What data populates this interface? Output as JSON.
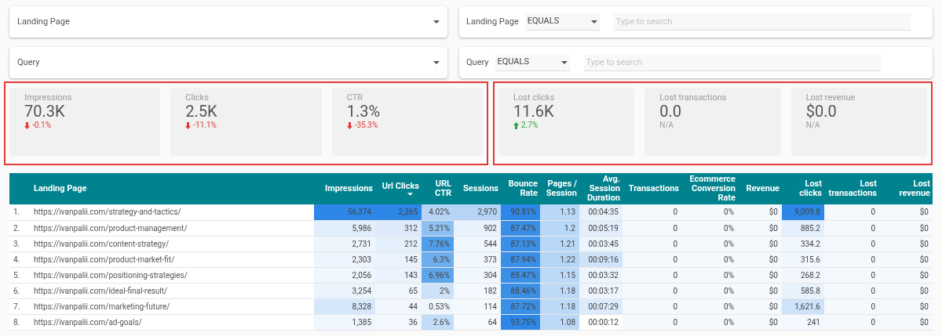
{
  "filters": [
    {
      "label": "Landing Page"
    },
    {
      "label": "Query"
    }
  ],
  "search_filters": [
    {
      "label": "Landing Page",
      "operator": "EQUALS",
      "placeholder": "Type to search"
    },
    {
      "label": "Query",
      "operator": "EQUALS",
      "placeholder": "Type to search"
    }
  ],
  "scorecard_groups": [
    {
      "cards": [
        {
          "title": "Impressions",
          "value": "70.3K",
          "rising": false,
          "delta": "-0.1%",
          "color": "#e53935"
        },
        {
          "title": "Clicks",
          "value": "2.5K",
          "rising": false,
          "delta": "-11.1%",
          "color": "#e53935"
        },
        {
          "title": "CTR",
          "value": "1.3%",
          "rising": false,
          "delta": "-35.3%",
          "color": "#e53935"
        }
      ]
    },
    {
      "cards": [
        {
          "title": "Lost clicks",
          "value": "11.6K",
          "rising": true,
          "delta": "2.7%",
          "color": "#2e9e44"
        },
        {
          "title": "Lost transactions",
          "value": "0.0",
          "delta": "N/A"
        },
        {
          "title": "Lost revenue",
          "value": "$0.0",
          "delta": "N/A"
        }
      ]
    }
  ],
  "table": {
    "columns": [
      {
        "label": "Landing Page",
        "sorted": false
      },
      {
        "label": "Impressions",
        "sorted": false
      },
      {
        "label": "Url Clicks",
        "sorted": true
      },
      {
        "label": "URL CTR",
        "sorted": false
      },
      {
        "label": "Sessions",
        "sorted": false
      },
      {
        "label": "Bounce Rate",
        "sorted": false
      },
      {
        "label": "Pages / Session",
        "sorted": false
      },
      {
        "label": "Avg. Session Duration",
        "sorted": false
      },
      {
        "label": "Transactions",
        "sorted": false
      },
      {
        "label": "Ecommerce Conversion Rate",
        "sorted": false
      },
      {
        "label": "Revenue",
        "sorted": false
      },
      {
        "label": "Lost clicks",
        "sorted": false
      },
      {
        "label": "Lost transactions",
        "sorted": false
      },
      {
        "label": "Lost revenue",
        "sorted": false
      }
    ],
    "rows": [
      {
        "index": "1.",
        "cells": [
          {
            "text": "https://ivanpalii.com/strategy-and-tactics/"
          },
          {
            "text": "56,374",
            "color": "#2c87e6"
          },
          {
            "text": "2,265",
            "color": "#2c87e6"
          },
          {
            "text": "4.02%",
            "color": "#b6d5f6"
          },
          {
            "text": "2,970",
            "color": "#b6d5f6"
          },
          {
            "text": "90.81%",
            "color": "#2c87e6"
          },
          {
            "text": "1.13",
            "color": "#b9d8f7"
          },
          {
            "text": "00:04:35",
            "color": "#e6f1fc"
          },
          {
            "text": "0",
            "color": "#f5f9fe"
          },
          {
            "text": "0%",
            "color": "#f5f9fe"
          },
          {
            "text": "$0",
            "color": "#f5f9fe"
          },
          {
            "text": "9,009.8",
            "color": "#2c87e6"
          },
          {
            "text": "0",
            "color": "#f5f9fe"
          },
          {
            "text": "$0",
            "color": "#f5f9fe"
          }
        ]
      },
      {
        "index": "2.",
        "cells": [
          {
            "text": "https://ivanpalii.com/product-management/"
          },
          {
            "text": "5,986",
            "color": "#e1eefc"
          },
          {
            "text": "312",
            "color": "#dceafb"
          },
          {
            "text": "5.21%",
            "color": "#8fc0f2"
          },
          {
            "text": "902",
            "color": "#e8f2fd"
          },
          {
            "text": "87.47%",
            "color": "#3a8fe6"
          },
          {
            "text": "1.2",
            "color": "#b9d8f7"
          },
          {
            "text": "00:05:19",
            "color": "#e2eefc"
          },
          {
            "text": "0",
            "color": "#f5f9fe"
          },
          {
            "text": "0%",
            "color": "#f5f9fe"
          },
          {
            "text": "$0",
            "color": "#f5f9fe"
          },
          {
            "text": "885.2",
            "color": "#e3effc"
          },
          {
            "text": "0",
            "color": "#f5f9fe"
          },
          {
            "text": "$0",
            "color": "#f5f9fe"
          }
        ]
      },
      {
        "index": "3.",
        "cells": [
          {
            "text": "https://ivanpalii.com/content-strategy/"
          },
          {
            "text": "2,731",
            "color": "#edf5fd"
          },
          {
            "text": "212",
            "color": "#e4effc"
          },
          {
            "text": "7.76%",
            "color": "#4f9ee9"
          },
          {
            "text": "544",
            "color": "#f0f6fe"
          },
          {
            "text": "87.13%",
            "color": "#3a8fe6"
          },
          {
            "text": "1.21",
            "color": "#b9d8f7"
          },
          {
            "text": "00:03:45",
            "color": "#ecf4fd"
          },
          {
            "text": "0",
            "color": "#f5f9fe"
          },
          {
            "text": "0%",
            "color": "#f5f9fe"
          },
          {
            "text": "$0",
            "color": "#f5f9fe"
          },
          {
            "text": "334.2",
            "color": "#f0f6fe"
          },
          {
            "text": "0",
            "color": "#f5f9fe"
          },
          {
            "text": "$0",
            "color": "#f5f9fe"
          }
        ]
      },
      {
        "index": "4.",
        "cells": [
          {
            "text": "https://ivanpalii.com/product-market-fit/"
          },
          {
            "text": "2,303",
            "color": "#eef5fe"
          },
          {
            "text": "145",
            "color": "#eaf3fd"
          },
          {
            "text": "6.3%",
            "color": "#6eaeed"
          },
          {
            "text": "373",
            "color": "#f1f7fe"
          },
          {
            "text": "87.94%",
            "color": "#3a8fe6"
          },
          {
            "text": "1.22",
            "color": "#b5d5f6"
          },
          {
            "text": "00:09:16",
            "color": "#cfe3f9"
          },
          {
            "text": "0",
            "color": "#f5f9fe"
          },
          {
            "text": "0%",
            "color": "#f5f9fe"
          },
          {
            "text": "$0",
            "color": "#f5f9fe"
          },
          {
            "text": "315.6",
            "color": "#f1f7fe"
          },
          {
            "text": "0",
            "color": "#f5f9fe"
          },
          {
            "text": "$0",
            "color": "#f5f9fe"
          }
        ]
      },
      {
        "index": "5.",
        "cells": [
          {
            "text": "https://ivanpalii.com/positioning-strategies/"
          },
          {
            "text": "2,056",
            "color": "#eff6fe"
          },
          {
            "text": "143",
            "color": "#eaf3fd"
          },
          {
            "text": "6.96%",
            "color": "#5ea5ea"
          },
          {
            "text": "304",
            "color": "#f1f7fe"
          },
          {
            "text": "89.47%",
            "color": "#3a8fe6"
          },
          {
            "text": "1.15",
            "color": "#bcd9f7"
          },
          {
            "text": "00:03:32",
            "color": "#edf5fd"
          },
          {
            "text": "0",
            "color": "#f5f9fe"
          },
          {
            "text": "0%",
            "color": "#f5f9fe"
          },
          {
            "text": "$0",
            "color": "#f5f9fe"
          },
          {
            "text": "268.2",
            "color": "#f2f7fe"
          },
          {
            "text": "0",
            "color": "#f5f9fe"
          },
          {
            "text": "$0",
            "color": "#f5f9fe"
          }
        ]
      },
      {
        "index": "6.",
        "cells": [
          {
            "text": "https://ivanpalii.com/ideal-final-result/"
          },
          {
            "text": "3,254",
            "color": "#ebf4fd"
          },
          {
            "text": "65",
            "color": "#f1f7fe"
          },
          {
            "text": "2%",
            "color": "#cce2f9"
          },
          {
            "text": "182",
            "color": "#f3f8fe"
          },
          {
            "text": "88.46%",
            "color": "#3a8fe6"
          },
          {
            "text": "1.18",
            "color": "#bcd9f7"
          },
          {
            "text": "00:03:17",
            "color": "#eef5fd"
          },
          {
            "text": "0",
            "color": "#f5f9fe"
          },
          {
            "text": "0%",
            "color": "#f5f9fe"
          },
          {
            "text": "$0",
            "color": "#f5f9fe"
          },
          {
            "text": "585.8",
            "color": "#e8f2fd"
          },
          {
            "text": "0",
            "color": "#f5f9fe"
          },
          {
            "text": "$0",
            "color": "#f5f9fe"
          }
        ]
      },
      {
        "index": "7.",
        "cells": [
          {
            "text": "https://ivanpalii.com/marketing-future/"
          },
          {
            "text": "8,328",
            "color": "#d5e8fb"
          },
          {
            "text": "44",
            "color": "#f2f7fe"
          },
          {
            "text": "0.53%",
            "color": "#f0f6fe"
          },
          {
            "text": "114",
            "color": "#f4f9fe"
          },
          {
            "text": "87.72%",
            "color": "#3a8fe6"
          },
          {
            "text": "1.18",
            "color": "#bcd9f7"
          },
          {
            "text": "00:07:29",
            "color": "#dbebfc"
          },
          {
            "text": "0",
            "color": "#f5f9fe"
          },
          {
            "text": "0%",
            "color": "#f5f9fe"
          },
          {
            "text": "$0",
            "color": "#f5f9fe"
          },
          {
            "text": "1,621.6",
            "color": "#cde3f9"
          },
          {
            "text": "0",
            "color": "#f5f9fe"
          },
          {
            "text": "$0",
            "color": "#f5f9fe"
          }
        ]
      },
      {
        "index": "8.",
        "cells": [
          {
            "text": "https://ivanpalii.com/ad-goals/"
          },
          {
            "text": "1,385",
            "color": "#f0f6fe"
          },
          {
            "text": "36",
            "color": "#f3f8fe"
          },
          {
            "text": "2.6%",
            "color": "#c2ddf8"
          },
          {
            "text": "64",
            "color": "#f6fafe"
          },
          {
            "text": "93.75%",
            "color": "#2c87e6"
          },
          {
            "text": "1.08",
            "color": "#bcd9f7"
          },
          {
            "text": "00:00:12",
            "color": "#ffffff"
          },
          {
            "text": "0",
            "color": "#f5f9fe"
          },
          {
            "text": "0%",
            "color": "#f5f9fe"
          },
          {
            "text": "$0",
            "color": "#f5f9fe"
          },
          {
            "text": "241",
            "color": "#f3f8fe"
          },
          {
            "text": "0",
            "color": "#f5f9fe"
          },
          {
            "text": "$0",
            "color": "#f5f9fe"
          }
        ]
      }
    ]
  }
}
